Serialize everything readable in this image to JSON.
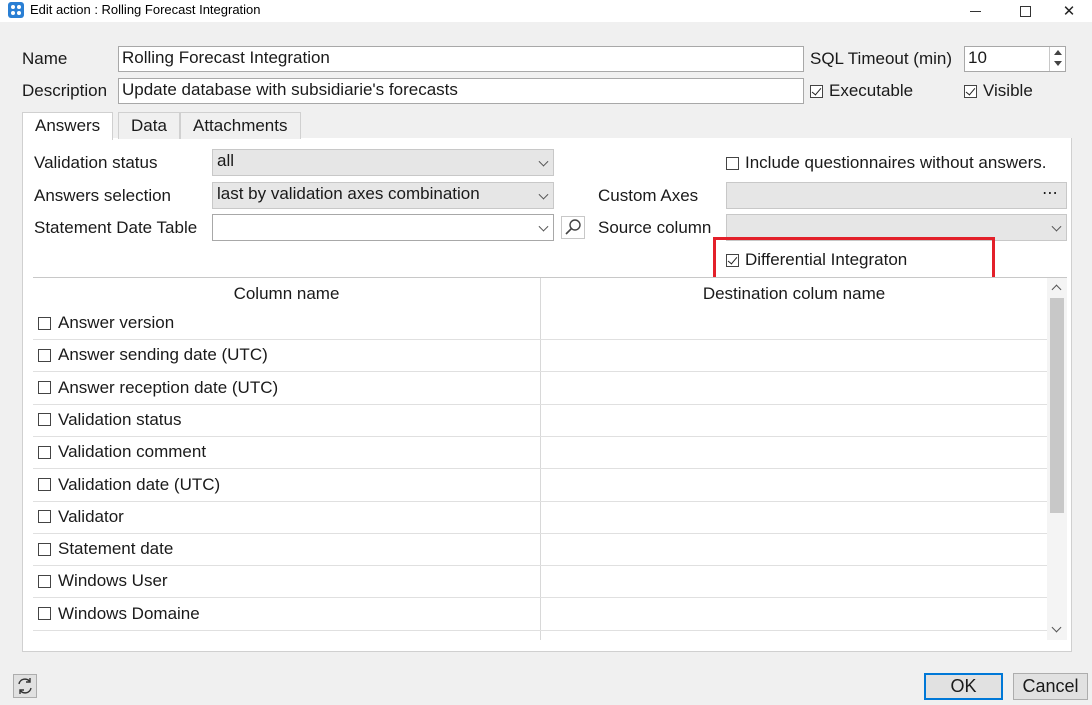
{
  "window": {
    "title": "Edit action : Rolling Forecast Integration",
    "icons": [
      "app-icon",
      "minimize-icon",
      "maximize-icon",
      "close-icon"
    ]
  },
  "form": {
    "name_label": "Name",
    "name_value": "Rolling Forecast Integration",
    "description_label": "Description",
    "description_value": "Update database with subsidiarie's forecasts",
    "sql_timeout_label": "SQL Timeout (min)",
    "sql_timeout_value": "10",
    "executable_label": "Executable",
    "executable_checked": true,
    "visible_label": "Visible",
    "visible_checked": true
  },
  "tabs": [
    {
      "label": "Answers",
      "active": true
    },
    {
      "label": "Data",
      "active": false
    },
    {
      "label": "Attachments",
      "active": false
    }
  ],
  "answers": {
    "validation_status_label": "Validation status",
    "validation_status_value": "all",
    "answers_selection_label": "Answers selection",
    "answers_selection_value": "last by validation axes combination",
    "statement_date_table_label": "Statement Date Table",
    "statement_date_table_value": "",
    "include_questionnaires_label": "Include questionnaires without answers.",
    "include_questionnaires_checked": false,
    "custom_axes_label": "Custom Axes",
    "custom_axes_button": "⋯",
    "source_column_label": "Source column",
    "differential_label": "Differential Integraton",
    "differential_checked": true
  },
  "grid": {
    "columns": [
      "Column name",
      "Destination colum name"
    ],
    "rows": [
      {
        "label": "Answer version",
        "checked": false,
        "destination": ""
      },
      {
        "label": "Answer sending date (UTC)",
        "checked": false,
        "destination": ""
      },
      {
        "label": "Answer reception date (UTC)",
        "checked": false,
        "destination": ""
      },
      {
        "label": "Validation status",
        "checked": false,
        "destination": ""
      },
      {
        "label": "Validation comment",
        "checked": false,
        "destination": ""
      },
      {
        "label": "Validation date (UTC)",
        "checked": false,
        "destination": ""
      },
      {
        "label": "Validator",
        "checked": false,
        "destination": ""
      },
      {
        "label": "Statement date",
        "checked": false,
        "destination": ""
      },
      {
        "label": "Windows User",
        "checked": false,
        "destination": ""
      },
      {
        "label": "Windows Domaine",
        "checked": false,
        "destination": ""
      }
    ]
  },
  "footer": {
    "ok_label": "OK",
    "cancel_label": "Cancel",
    "refresh_icon": "refresh-icon"
  },
  "colors": {
    "highlight": "#e3202a",
    "default_button_border": "#0078d7"
  }
}
